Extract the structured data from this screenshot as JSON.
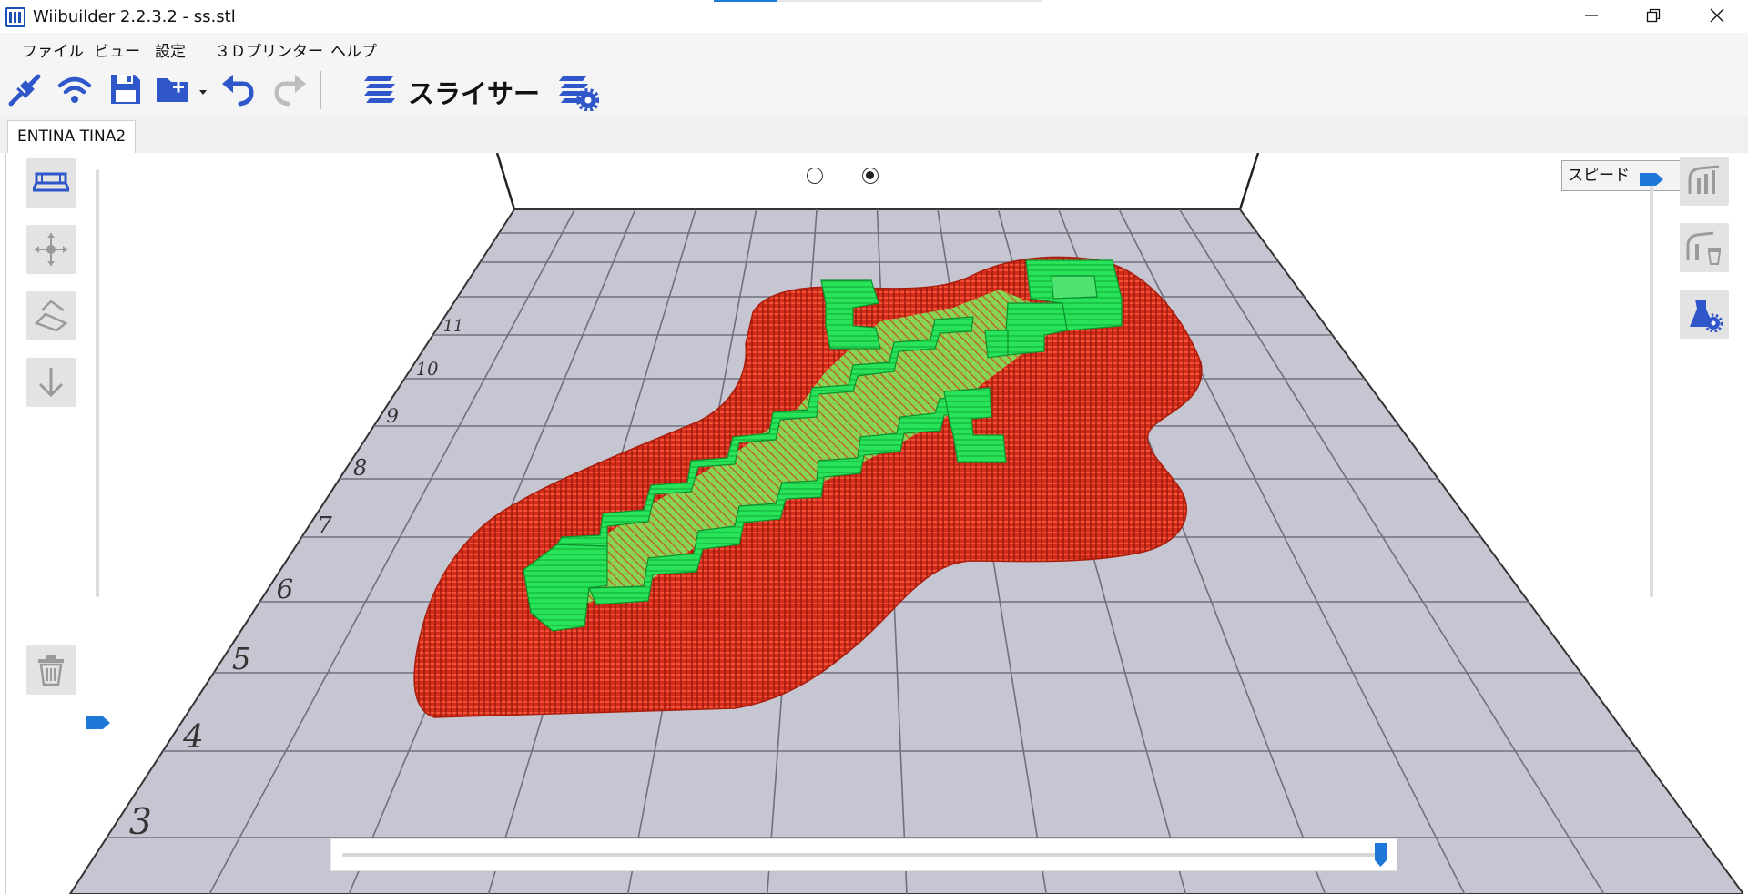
{
  "window": {
    "title": "Wiibuilder 2.2.3.2 - ss.stl",
    "minimize_glyph": "—",
    "restore_glyph": "❐",
    "close_glyph": "✕"
  },
  "menu": {
    "items": [
      "ファイル",
      "ビュー",
      "設定",
      "３Ｄプリンター",
      "ヘルプ"
    ]
  },
  "toolbar": {
    "slicer_label": "スライサー",
    "icons": [
      "connect-icon",
      "wifi-icon",
      "save-icon",
      "open-folder-icon",
      "dropdown-arrow-icon",
      "undo-icon",
      "redo-icon",
      "layers-icon",
      "layers-settings-icon"
    ]
  },
  "tab": {
    "label": "ENTINA TINA2"
  },
  "viewport": {
    "view_mode_selected_index": 1,
    "display_select": {
      "selected": "スピード",
      "caret": "⌄"
    },
    "grid_labels": [
      "3",
      "4",
      "5",
      "6",
      "7",
      "8",
      "9",
      "10",
      "11"
    ],
    "left_tools": [
      "build-plate-icon",
      "move-icon",
      "rotate-icon",
      "drop-down-icon",
      "delete-icon"
    ],
    "right_tools": [
      "support-icon",
      "support-delete-icon",
      "support-settings-icon"
    ],
    "layer_slider": {
      "position_fraction": 1.0
    },
    "left_slider": {
      "position_fraction": 0.0
    },
    "right_slider": {
      "position_fraction": 1.0
    }
  },
  "colors": {
    "accent": "#1e78d7",
    "toolbar_icon": "#2f57c9",
    "infill": "#e8321e",
    "walls": "#2ee85e",
    "bed": "#c5c5d1",
    "grid_line": "#6e6e7a"
  }
}
